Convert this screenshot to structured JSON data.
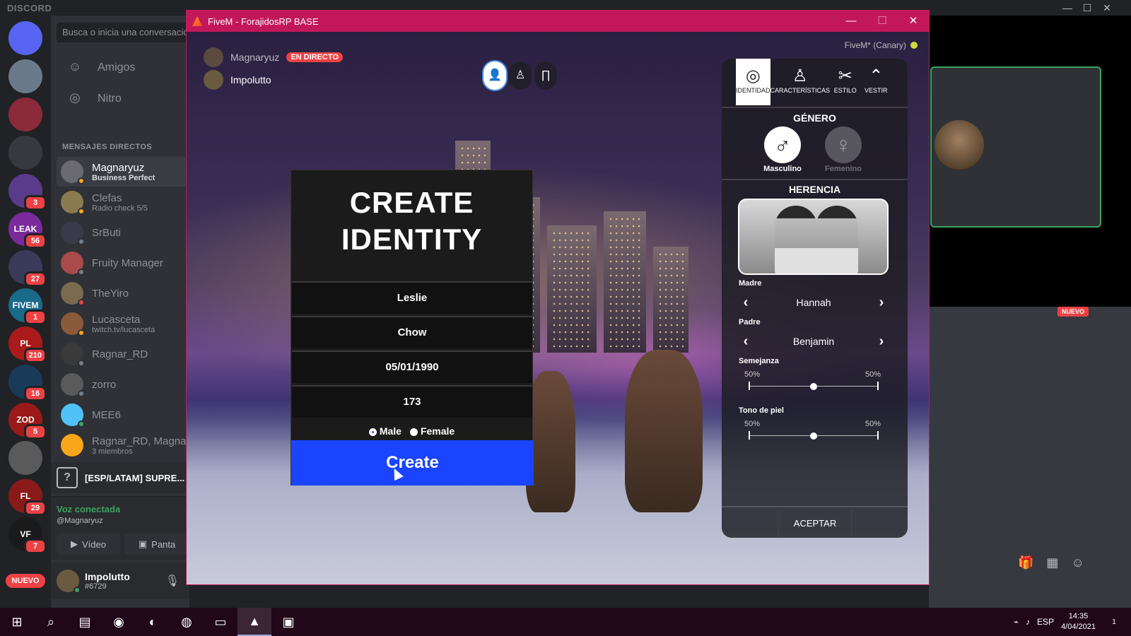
{
  "discord": {
    "brand": "DISCORD",
    "search_placeholder": "Busca o inicia una conversación",
    "nav": [
      {
        "label": "Amigos",
        "icon": "friends-icon"
      },
      {
        "label": "Nitro",
        "icon": "nitro-icon"
      }
    ],
    "dm_header": "MENSAJES DIRECTOS",
    "dms": [
      {
        "name": "Magnaryuz",
        "sub": "Business Perfect",
        "active": true,
        "status": "#faa61a",
        "avatar": "#6a6a70"
      },
      {
        "name": "Clefas",
        "sub": "Radio check 5/5",
        "active": false,
        "status": "#faa61a",
        "avatar": "#8a7a50"
      },
      {
        "name": "SrButi",
        "sub": "",
        "active": false,
        "status": "#747f8d",
        "avatar": "#3a3a4a"
      },
      {
        "name": "Fruity Manager",
        "sub": "",
        "active": false,
        "status": "#747f8d",
        "avatar": "#aa4a4a"
      },
      {
        "name": "TheYiro",
        "sub": "",
        "active": false,
        "status": "#ed4245",
        "avatar": "#7a6a50"
      },
      {
        "name": "Lucasceta",
        "sub": "twitch.tv/lucasceta",
        "active": false,
        "status": "#faa61a",
        "avatar": "#8a5a3a"
      },
      {
        "name": "Ragnar_RD",
        "sub": "",
        "active": false,
        "status": "#747f8d",
        "avatar": "#3a3a3a"
      },
      {
        "name": "zorro",
        "sub": "",
        "active": false,
        "status": "#747f8d",
        "avatar": "#5a5a5a"
      },
      {
        "name": "MEE6",
        "sub": "",
        "active": false,
        "status": "#3ba55d",
        "avatar": "#4fc3f7"
      },
      {
        "name": "Ragnar_RD, Magnaryuz",
        "sub": "3 miembros",
        "active": false,
        "status": "",
        "avatar": "#faa61a"
      }
    ],
    "servers": [
      {
        "label": "",
        "badge": "",
        "color": "#5865f2"
      },
      {
        "label": "",
        "badge": "",
        "color": "#6a7a8a"
      },
      {
        "label": "",
        "badge": "",
        "color": "#8a2a3a"
      },
      {
        "label": "",
        "badge": "",
        "color": "#36393f"
      },
      {
        "label": "",
        "badge": "3",
        "color": "#5a3a8a"
      },
      {
        "label": "LEAK",
        "badge": "56",
        "color": "#7a2a9a"
      },
      {
        "label": "",
        "badge": "27",
        "color": "#3a3a5a"
      },
      {
        "label": "FIVEM",
        "badge": "1",
        "color": "#1a6a8a"
      },
      {
        "label": "PL",
        "badge": "210",
        "color": "#aa1a1a"
      },
      {
        "label": "",
        "badge": "16",
        "color": "#1a3a5a"
      },
      {
        "label": "ZOD",
        "badge": "5",
        "color": "#9a1a1a"
      },
      {
        "label": "",
        "badge": "",
        "color": "#5a5a5a"
      },
      {
        "label": "FL",
        "badge": "29",
        "color": "#8a1a1a"
      },
      {
        "label": "VF",
        "badge": "7",
        "color": "#1a1a1a"
      }
    ],
    "nuevo": "NUEVO",
    "server_name": "[ESP/LATAM] SUPRE...",
    "voice_status": "Voz conectada",
    "voice_user": "@Magnaryuz",
    "video_label": "Vídeo",
    "screen_label": "Panta",
    "user_name": "Impolutto",
    "user_tag": "#6729",
    "right_nuevo": "NUEVO"
  },
  "fivem": {
    "title": "FiveM - ForajidosRP BASE",
    "build": "FiveM* (Canary)",
    "streamer": "Magnaryuz",
    "live": "EN DIRECTO",
    "viewer": "Impolutto"
  },
  "identity": {
    "title_line1": "CREATE",
    "title_line2": "IDENTITY",
    "first_name": "Leslie",
    "last_name": "Chow",
    "dob": "05/01/1990",
    "height": "173",
    "male": "Male",
    "female": "Female",
    "selected_gender": "male",
    "create": "Create",
    "accent": "#1a44ff"
  },
  "character": {
    "tabs": [
      {
        "label": "IDENTIDAD",
        "icon": "fingerprint-icon",
        "active": true
      },
      {
        "label": "CARACTERÍSTICAS",
        "icon": "body-icon",
        "active": false
      },
      {
        "label": "ESTILO",
        "icon": "scissors-icon",
        "active": false
      },
      {
        "label": "VESTIR",
        "icon": "hanger-icon",
        "active": false
      }
    ],
    "gender_title": "GÉNERO",
    "male_label": "Masculino",
    "female_label": "Femenino",
    "heritage_title": "HERENCIA",
    "mother_label": "Madre",
    "mother_value": "Hannah",
    "father_label": "Padre",
    "father_value": "Benjamin",
    "resemblance_label": "Semejanza",
    "resemblance_left": "50%",
    "resemblance_right": "50%",
    "resemblance_value": 0.5,
    "skin_label": "Tono de piel",
    "skin_left": "50%",
    "skin_right": "50%",
    "skin_value": 0.5,
    "accept": "ACEPTAR"
  },
  "taskbar": {
    "lang": "ESP",
    "time": "14:35",
    "date": "4/04/2021",
    "notif": "1"
  }
}
